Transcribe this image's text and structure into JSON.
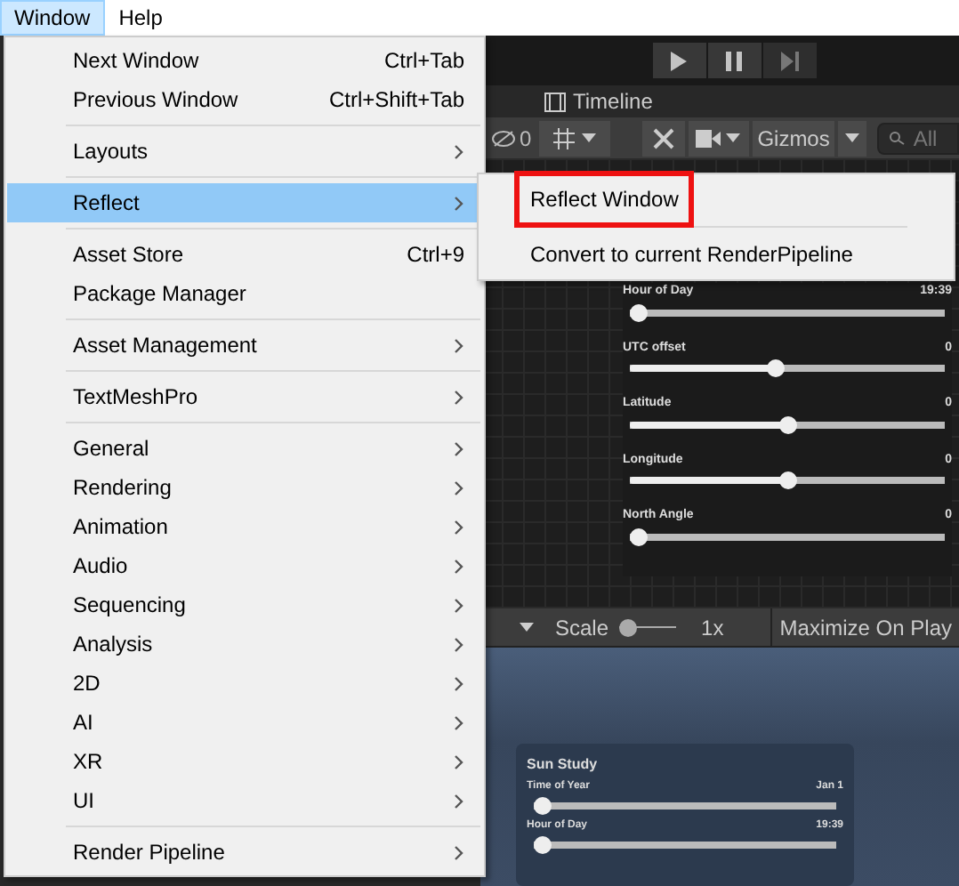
{
  "menu_bar": [
    {
      "label": "Window",
      "selected": true
    },
    {
      "label": "Help",
      "selected": false
    }
  ],
  "window_menu": {
    "groups": [
      [
        {
          "label": "Next Window",
          "shortcut": "Ctrl+Tab",
          "submenu": false,
          "selected": false
        },
        {
          "label": "Previous Window",
          "shortcut": "Ctrl+Shift+Tab",
          "submenu": false,
          "selected": false
        }
      ],
      [
        {
          "label": "Layouts",
          "submenu": true,
          "selected": false
        }
      ],
      [
        {
          "label": "Reflect",
          "submenu": true,
          "selected": true
        }
      ],
      [
        {
          "label": "Asset Store",
          "shortcut": "Ctrl+9",
          "submenu": false,
          "selected": false
        },
        {
          "label": "Package Manager",
          "submenu": false,
          "selected": false
        }
      ],
      [
        {
          "label": "Asset Management",
          "submenu": true,
          "selected": false
        }
      ],
      [
        {
          "label": "TextMeshPro",
          "submenu": true,
          "selected": false
        }
      ],
      [
        {
          "label": "General",
          "submenu": true,
          "selected": false
        },
        {
          "label": "Rendering",
          "submenu": true,
          "selected": false
        },
        {
          "label": "Animation",
          "submenu": true,
          "selected": false
        },
        {
          "label": "Audio",
          "submenu": true,
          "selected": false
        },
        {
          "label": "Sequencing",
          "submenu": true,
          "selected": false
        },
        {
          "label": "Analysis",
          "submenu": true,
          "selected": false
        },
        {
          "label": "2D",
          "submenu": true,
          "selected": false
        },
        {
          "label": "AI",
          "submenu": true,
          "selected": false
        },
        {
          "label": "XR",
          "submenu": true,
          "selected": false
        },
        {
          "label": "UI",
          "submenu": true,
          "selected": false
        }
      ],
      [
        {
          "label": "Render Pipeline",
          "submenu": true,
          "selected": false
        }
      ]
    ]
  },
  "reflect_submenu": [
    {
      "label": "Reflect Window",
      "highlighted": true
    },
    {
      "label": "Convert to current RenderPipeline",
      "highlighted": false
    }
  ],
  "scene_tabs": [
    {
      "label": "Timeline"
    }
  ],
  "scene_toolbar": {
    "hidden_count": "0",
    "gizmos": "Gizmos",
    "search_placeholder": "All"
  },
  "scene_sliders": [
    {
      "label": "Hour of Day",
      "value": "19:39",
      "level": 0
    },
    {
      "label": "UTC offset",
      "value": "0",
      "level": 0.46
    },
    {
      "label": "Latitude",
      "value": "0",
      "level": 0.5
    },
    {
      "label": "Longitude",
      "value": "0",
      "level": 0.5
    },
    {
      "label": "North Angle",
      "value": "0",
      "level": 0
    }
  ],
  "game_toolbar": {
    "scale_label": "Scale",
    "scale_slider": {
      "level": 0
    },
    "scale_value": "1x",
    "maximize": "Maximize On Play"
  },
  "sun_study": {
    "title": "Sun Study",
    "sliders": [
      {
        "label": "Time of Year",
        "value": "Jan 1",
        "level": 0
      },
      {
        "label": "Hour of Day",
        "value": "19:39",
        "level": 0
      }
    ]
  }
}
